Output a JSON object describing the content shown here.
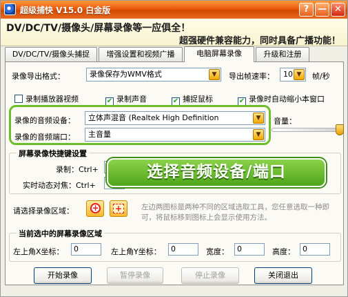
{
  "window": {
    "title": "超级捕快 V15.0 白金版",
    "btn_min": "—",
    "btn_close": "✕",
    "btn_extra": "?"
  },
  "header": {
    "slogan1": "DV/DC/TV/摄像头/屏幕录像等一应俱全！",
    "slogan2": "超强硬件兼容能力，同时具备广播功能！"
  },
  "tabs": [
    "DV/DC/TV/摄像头捕捉",
    "增强设置和视频广播",
    "电脑屏幕录像",
    "升级和注册"
  ],
  "active_tab": "电脑屏幕录像",
  "export": {
    "label": "录像导出格式：",
    "format_value": "录像保存为WMV格式",
    "fps_label": "导出帧速率：",
    "fps_value": "10",
    "fps_unit": "帧/秒"
  },
  "checkboxes": [
    {
      "label": "录制播放器视频",
      "checked": false
    },
    {
      "label": "录制声音",
      "checked": true
    },
    {
      "label": "捕捉鼠标",
      "checked": true
    },
    {
      "label": "录像时自动缩小本窗口",
      "checked": true
    }
  ],
  "audio": {
    "device_label": "录像的音频设备：",
    "device_value": "立体声混音 (Realtek High Definition",
    "port_label": "录像的音频端口：",
    "port_value": "主音量",
    "volume_label": "音量：",
    "volume_level": 1.0
  },
  "hotkeys": {
    "group_title": "屏幕录像快捷键设置",
    "record_label": "录制：Ctrl+",
    "dynamic_label": "实时动态对焦：Ctrl+"
  },
  "overlay_text": "选择音频设备/端口",
  "region": {
    "label": "请选择录像区域：",
    "hint": "左边两图标是两种不同的区域选取工具，您任意选取一种即可，将鼠标移到图标上会显示使用方法。",
    "btn1_symbol": "+",
    "btn2_symbol": "+"
  },
  "current_region": {
    "group_title": "当前选中的屏幕录像区域",
    "x_label": "左上角X坐标：",
    "x_value": "0",
    "y_label": "左上角Y坐标：",
    "y_value": "0",
    "w_label": "宽度：",
    "w_value": "0",
    "h_label": "高度：",
    "h_value": "0"
  },
  "buttons": {
    "start": "开始录像",
    "pause": "暂停录像",
    "stop": "停止录像",
    "close": "关闭退出"
  },
  "colors": {
    "accent": "#e85a0c",
    "highlight": "#6cbf2a"
  }
}
